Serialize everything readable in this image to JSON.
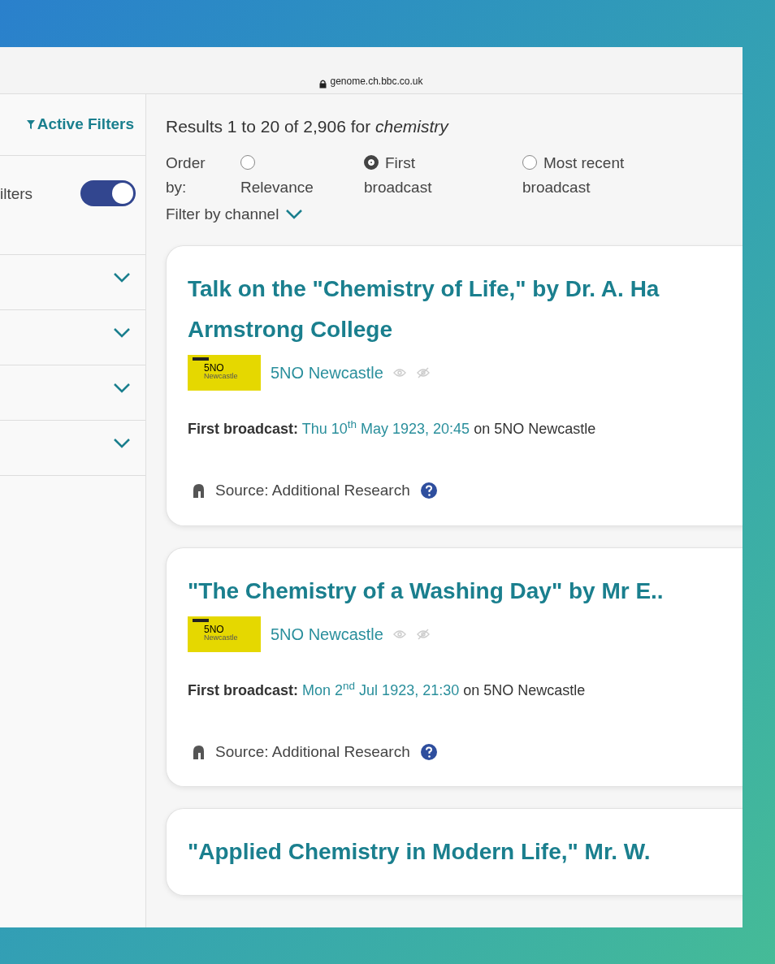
{
  "browser": {
    "url": "genome.ch.bbc.co.uk"
  },
  "sidebar": {
    "active_filters": "Active Filters",
    "toggle": {
      "label": "ilters",
      "on": true
    },
    "sections": [
      {
        "expanded": false
      },
      {
        "expanded": false
      },
      {
        "expanded": false
      },
      {
        "expanded": false
      }
    ]
  },
  "results": {
    "summary": "Results 1 to 20 of 2,906 for *chemistry*",
    "order_label": "Order by:",
    "order_options": [
      {
        "label": "Relevance",
        "selected": false
      },
      {
        "label": "First broadcast",
        "selected": true
      },
      {
        "label": "Most recent broadcast",
        "selected": false
      }
    ],
    "filter": "Filter by channel"
  },
  "programmes": [
    {
      "title_lines": [
        "Talk on the \"Chemistry of Life,\" by Dr. A. Ha",
        "Armstrong College"
      ],
      "logo_top": "5NO",
      "logo_bottom": "Newcastle",
      "channel": "5NO Newcastle",
      "broadcast_label": "First broadcast:",
      "date": "Thu 10$^{th}$ May 1923, 20:45",
      "on": "on 5NO Newcastle",
      "source": "Source: Additional Research"
    },
    {
      "title_lines": [
        "\"The Chemistry of a Washing Day\" by Mr E.."
      ],
      "logo_top": "5NO",
      "logo_bottom": "Newcastle",
      "channel": "5NO Newcastle",
      "broadcast_label": "First broadcast:",
      "date": "Mon 2$^{nd}$ Jul 1923, 21:30",
      "on": "on 5NO Newcastle",
      "source": "Source: Additional Research"
    },
    {
      "title_lines": [
        "\"Applied Chemistry in Modern Life,\" Mr. W."
      ]
    }
  ]
}
